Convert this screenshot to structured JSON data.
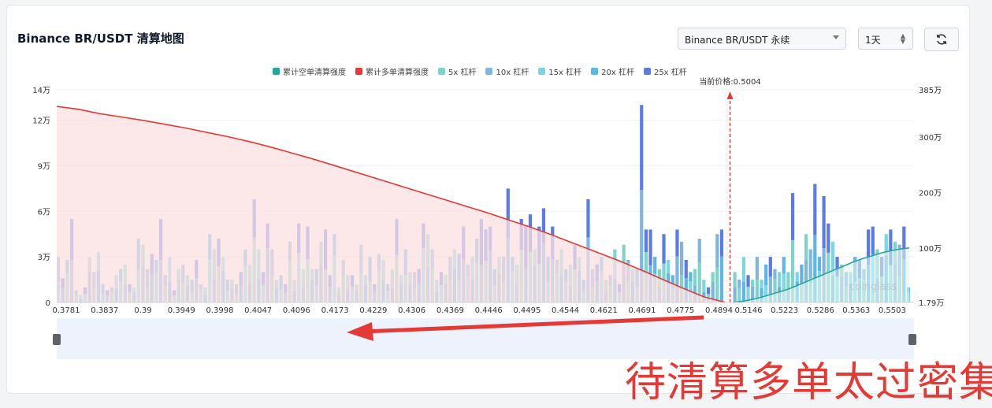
{
  "header": {
    "title": "Binance BR/USDT 清算地图",
    "exchange_select": "Binance BR/USDT 永续",
    "period_select": "1天"
  },
  "annotation": {
    "caption": "待清算多单太过密集",
    "current_price_label": "当前价格:0.5004",
    "watermark": "coinglass"
  },
  "colors": {
    "short_cum": "#26a69a",
    "long_cum": "#e53935",
    "lev5": "#7fd3c9",
    "lev10": "#7fb5de",
    "lev15": "#7ad6e3",
    "lev20": "#5fb4e8",
    "lev25": "#5b7be8",
    "arrow": "#e53935"
  },
  "chart_data": {
    "type": "bar",
    "legend": [
      "累计空单清算强度",
      "累计多单清算强度",
      "5x 杠杆",
      "10x 杠杆",
      "15x 杠杆",
      "20x 杠杆",
      "25x 杠杆"
    ],
    "x_tick_labels": [
      "0.3781",
      "0.3837",
      "0.39",
      "0.3949",
      "0.3998",
      "0.4047",
      "0.4096",
      "0.4173",
      "0.4229",
      "0.4306",
      "0.4369",
      "0.4446",
      "0.4495",
      "0.4544",
      "0.4621",
      "0.4691",
      "0.4775",
      "0.4894",
      "0.5146",
      "0.5223",
      "0.5286",
      "0.5363",
      "0.5503"
    ],
    "y_left_ticks": [
      "0",
      "3万",
      "6万",
      "9万",
      "12万",
      "14万"
    ],
    "y_left_range": [
      0,
      140000
    ],
    "y_right_ticks": [
      "1.79万",
      "100万",
      "200万",
      "300万",
      "385万"
    ],
    "y_right_range": [
      17900,
      3850000
    ],
    "current_price": 0.5004,
    "bars_left_of_price": [
      30000,
      16000,
      28000,
      55000,
      8000,
      5000,
      10000,
      30000,
      20000,
      33000,
      12000,
      8000,
      10000,
      18000,
      22000,
      25000,
      12000,
      10000,
      42000,
      38000,
      22000,
      32000,
      28000,
      55000,
      18000,
      30000,
      8000,
      22000,
      25000,
      18000,
      15000,
      28000,
      12000,
      10000,
      45000,
      35000,
      42000,
      30000,
      15000,
      15000,
      12000,
      20000,
      35000,
      25000,
      68000,
      35000,
      20000,
      52000,
      35000,
      15000,
      18000,
      12000,
      40000,
      15000,
      52000,
      22000,
      50000,
      22000,
      22000,
      40000,
      48000,
      18000,
      45000,
      10000,
      28000,
      18000,
      18000,
      12000,
      38000,
      18000,
      30000,
      12000,
      32000,
      28000,
      12000,
      22000,
      55000,
      18000,
      35000,
      20000,
      20000,
      22000,
      52000,
      45000,
      35000,
      15000,
      20000,
      18000,
      30000,
      35000,
      32000,
      50000,
      25000,
      30000,
      42000,
      55000,
      48000,
      50000,
      22000,
      30000,
      30000,
      75000,
      30000,
      25000,
      55000,
      50000,
      58000,
      35000,
      50000,
      62000,
      30000,
      50000,
      28000,
      35000,
      22000,
      25000,
      38000,
      30000,
      15000,
      68000,
      22000,
      25000,
      30000,
      15000,
      18000,
      35000,
      12000,
      38000,
      28000,
      22000,
      22000,
      130000,
      48000,
      48000,
      30000,
      22000,
      45000,
      28000,
      18000,
      48000,
      40000,
      28000,
      20000,
      22000,
      42000,
      15000,
      10000,
      20000,
      45000,
      48000
    ],
    "bars_right_of_price": [
      20000,
      15000,
      30000,
      18000,
      15000,
      30000,
      15000,
      25000,
      30000,
      22000,
      20000,
      30000,
      20000,
      72000,
      20000,
      25000,
      45000,
      35000,
      78000,
      30000,
      70000,
      52000,
      40000,
      30000,
      25000,
      20000,
      20000,
      30000,
      28000,
      22000,
      48000,
      50000,
      35000,
      30000,
      45000,
      48000,
      40000,
      38000,
      50000,
      10000
    ],
    "long_cumulative": [
      3550000,
      3500000,
      3420000,
      3360000,
      3300000,
      3230000,
      3160000,
      3080000,
      3000000,
      2910000,
      2810000,
      2700000,
      2590000,
      2470000,
      2350000,
      2230000,
      2110000,
      1990000,
      1870000,
      1750000,
      1630000,
      1500000,
      1370000,
      1230000,
      1080000,
      930000,
      780000,
      620000,
      450000,
      280000,
      120000,
      20000
    ],
    "short_cumulative": [
      20000,
      40000,
      70000,
      110000,
      160000,
      210000,
      260000,
      330000,
      400000,
      470000,
      540000,
      610000,
      680000,
      750000,
      810000,
      860000,
      910000,
      950000,
      980000,
      1000000
    ]
  }
}
